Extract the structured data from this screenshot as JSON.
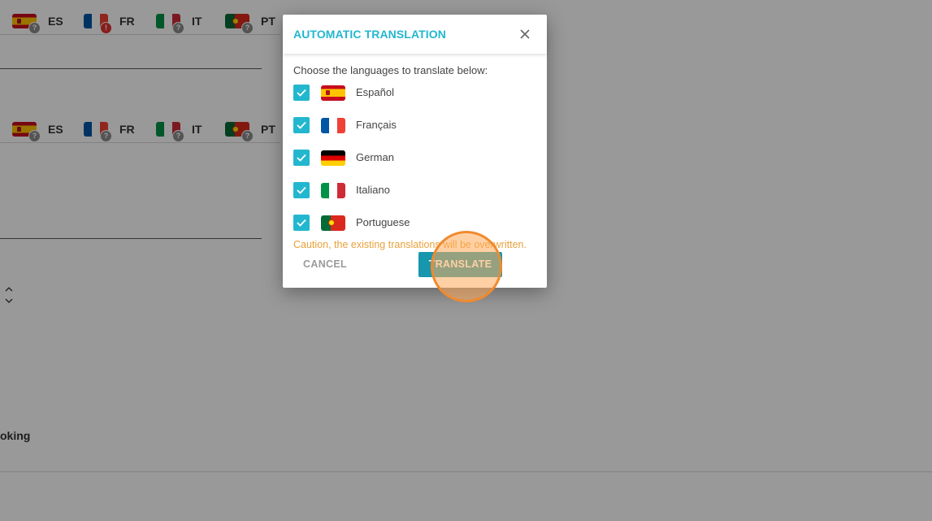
{
  "background": {
    "lang_rows": [
      [
        {
          "code": "ES",
          "flag": "es",
          "badge": "?"
        },
        {
          "code": "FR",
          "flag": "fr",
          "badge": "!"
        },
        {
          "code": "IT",
          "flag": "it",
          "badge": "?"
        },
        {
          "code": "PT",
          "flag": "pt",
          "badge": "?"
        }
      ],
      [
        {
          "code": "ES",
          "flag": "es",
          "badge": "?"
        },
        {
          "code": "FR",
          "flag": "fr",
          "badge": "?"
        },
        {
          "code": "IT",
          "flag": "it",
          "badge": "?"
        },
        {
          "code": "PT",
          "flag": "pt",
          "badge": "?"
        }
      ]
    ],
    "booking_label": "oking"
  },
  "dialog": {
    "title": "AUTOMATIC TRANSLATION",
    "instruction": "Choose the languages to translate below:",
    "languages": [
      {
        "label": "Español",
        "flag": "es",
        "checked": true
      },
      {
        "label": "Français",
        "flag": "fr",
        "checked": true
      },
      {
        "label": "German",
        "flag": "de",
        "checked": true
      },
      {
        "label": "Italiano",
        "flag": "it",
        "checked": true
      },
      {
        "label": "Portuguese",
        "flag": "pt",
        "checked": true
      }
    ],
    "caution": "Caution, the existing translations will be overwritten.",
    "cancel_label": "CANCEL",
    "translate_label": "TRANSLATE"
  },
  "colors": {
    "accent": "#23b7cf",
    "primary_button": "#1797ae",
    "caution": "#e8a13a",
    "error_badge": "#e03131"
  },
  "icons": [
    "close-icon",
    "check-icon",
    "sort-icon",
    "question-badge-icon",
    "error-badge-icon"
  ]
}
